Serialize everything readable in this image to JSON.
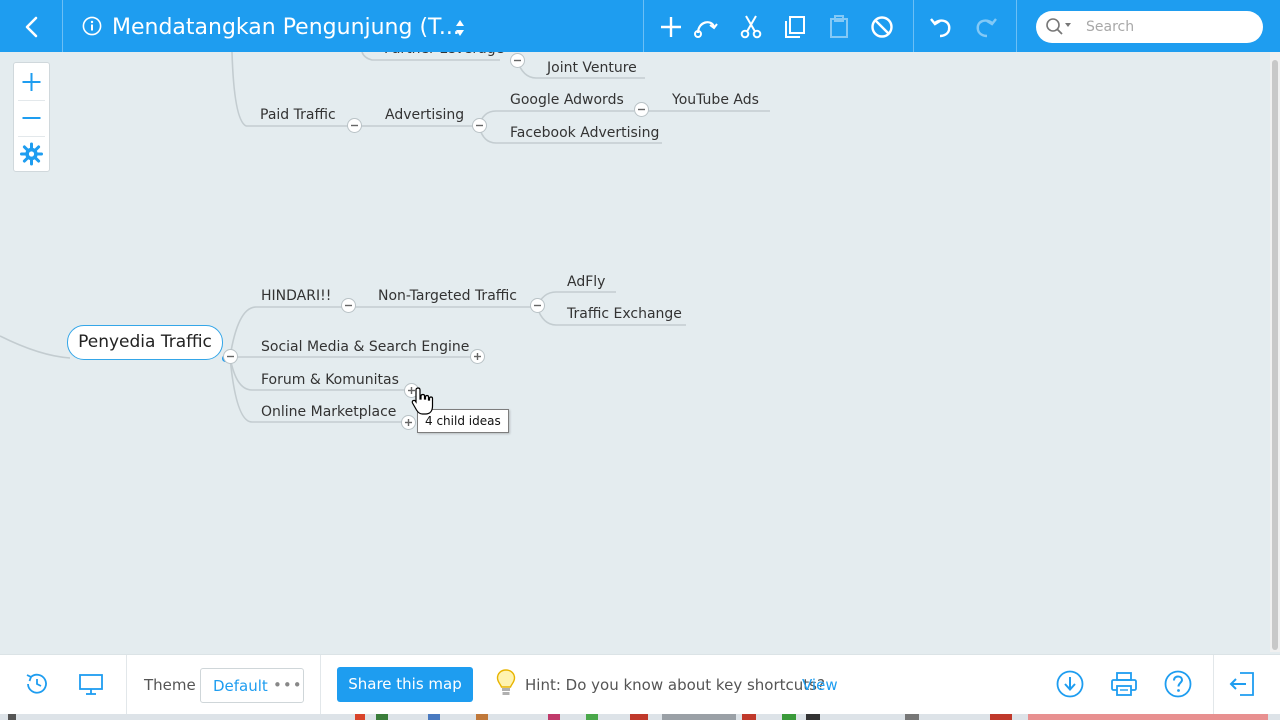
{
  "header": {
    "title": "Mendatangkan Pengunjung (T..."
  },
  "search": {
    "placeholder": "Search",
    "value": ""
  },
  "icons": {
    "back": "chevron-left-icon",
    "info": "info-icon",
    "add": "plus-icon",
    "connect": "connect-icon",
    "cut": "scissors-icon",
    "copy": "copy-icon",
    "paste": "paste-icon",
    "delete": "no-entry-icon",
    "undo": "undo-icon",
    "redo": "redo-icon",
    "search": "search-icon",
    "zoom_in": "plus-icon",
    "zoom_out": "minus-icon",
    "settings": "gear-icon",
    "history": "history-icon",
    "presentation": "presentation-icon",
    "download": "download-icon",
    "print": "printer-icon",
    "help": "help-icon",
    "exit": "exit-icon",
    "hint": "lightbulb-icon"
  },
  "mindmap": {
    "central": "Penyedia Traffic",
    "top_fragment": "Partner Leverage",
    "joint_venture": "Joint Venture",
    "paid_traffic": "Paid Traffic",
    "advertising": "Advertising",
    "google_adwords": "Google Adwords",
    "youtube_ads": "YouTube Ads",
    "facebook_advertising": "Facebook Advertising",
    "hindari": "HINDARI!!",
    "non_targeted": "Non-Targeted Traffic",
    "adfly": "AdFly",
    "traffic_exchange": "Traffic Exchange",
    "social_media": "Social Media & Search Engine",
    "forum": "Forum & Komunitas",
    "online_marketplace": "Online Marketplace"
  },
  "tooltip": {
    "text": "4 child ideas"
  },
  "footer": {
    "theme_label": "Theme",
    "theme_value": "Default",
    "theme_more": "•••",
    "share_label": "Share this map",
    "hint_text": "Hint: Do you know about key shortcuts?",
    "hint_link": "View"
  },
  "colors": {
    "accent": "#1e9df0",
    "canvas": "#e4ecef",
    "branch": "#c3ccd0"
  }
}
